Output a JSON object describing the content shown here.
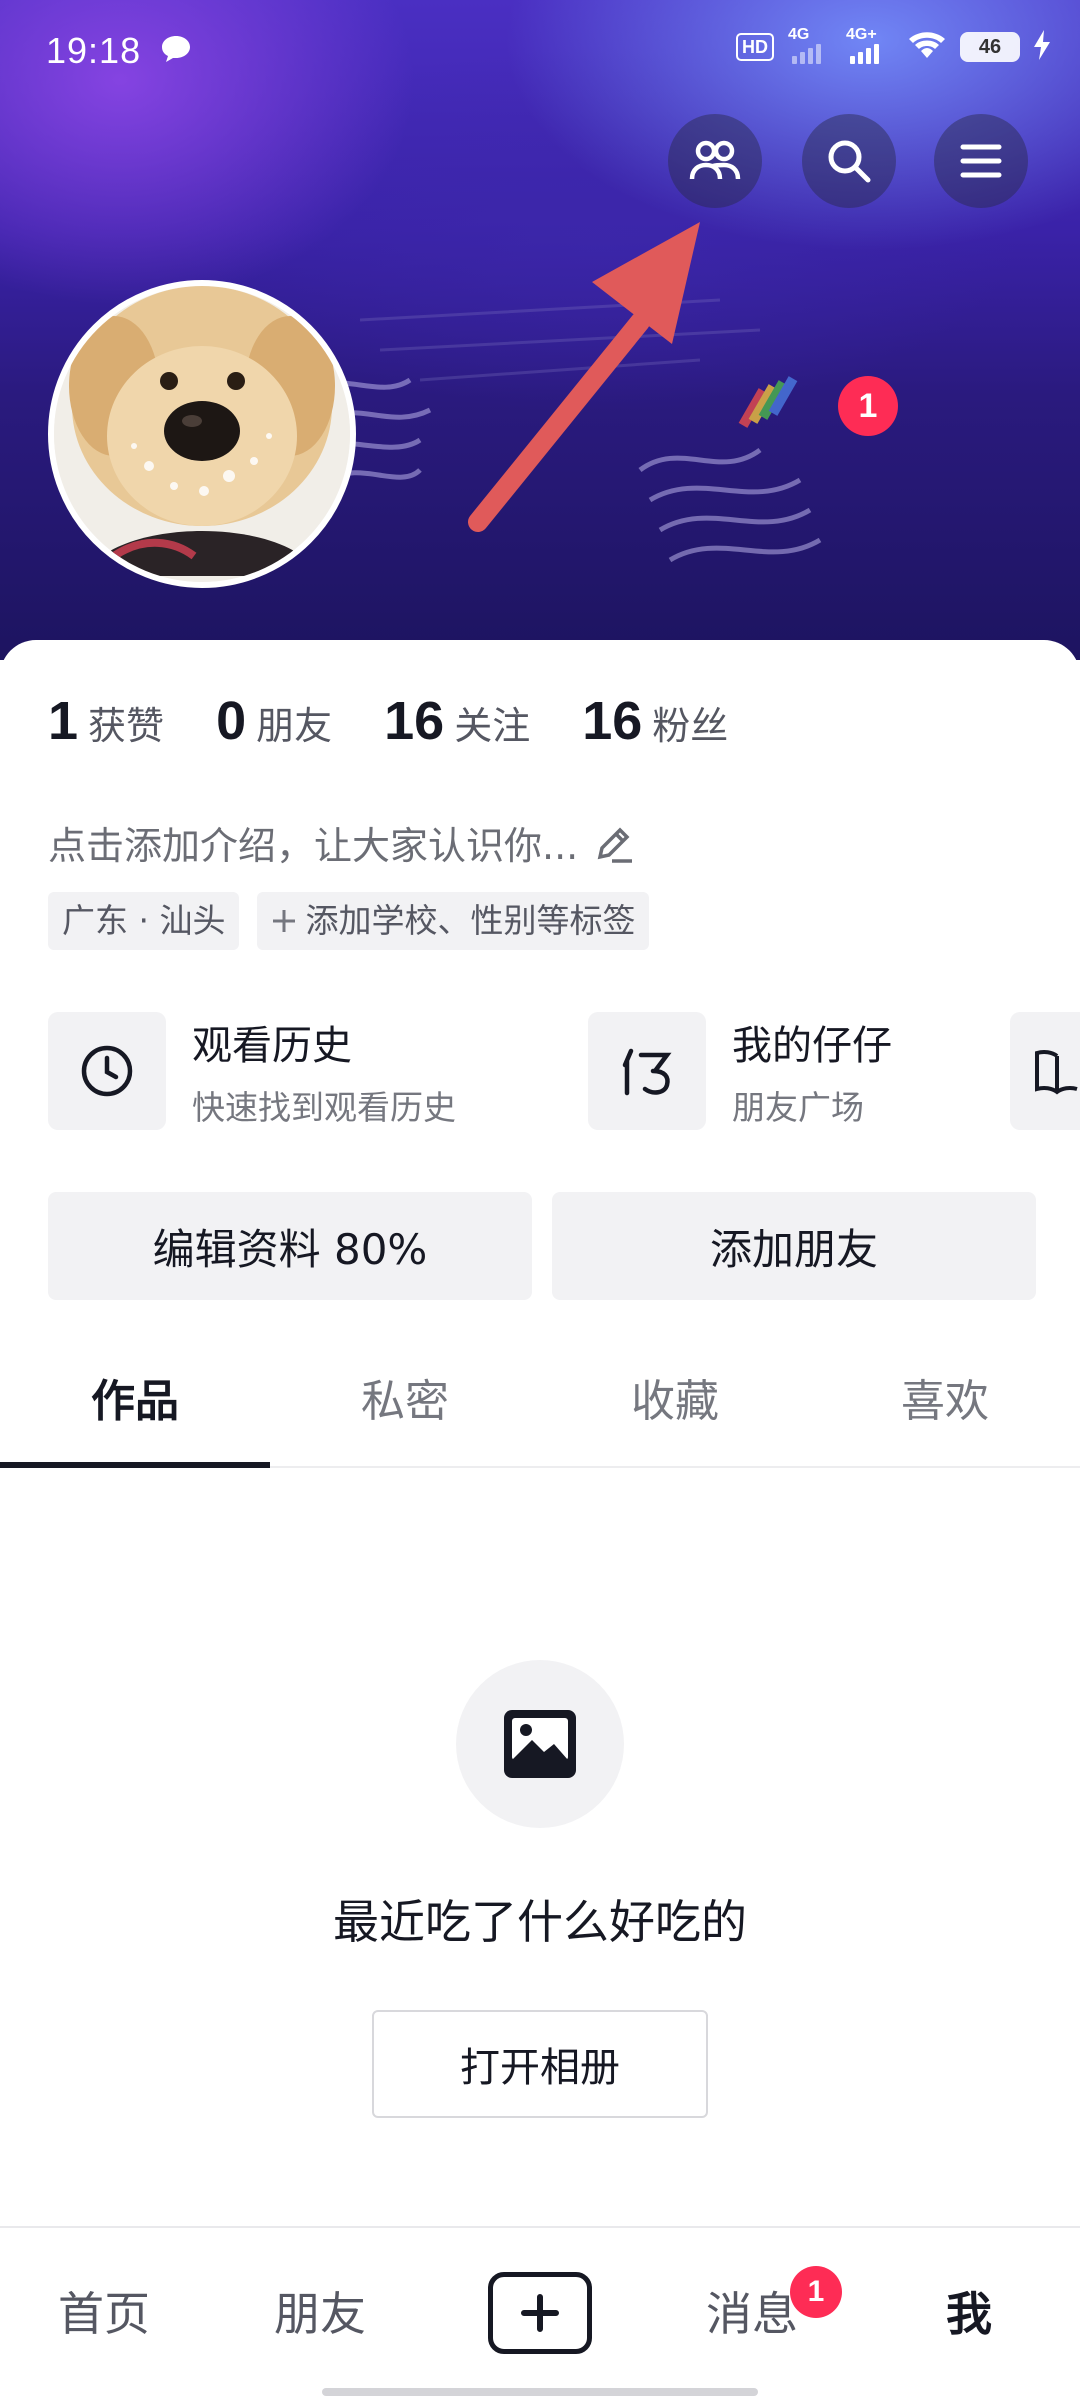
{
  "status_bar": {
    "time": "19:18",
    "hd_label": "HD",
    "signal1_label": "4G",
    "signal2_label": "4G+",
    "battery": "46",
    "icons": [
      "message-icon",
      "wifi-icon",
      "charging-icon"
    ]
  },
  "header": {
    "buttons": [
      "friends-icon",
      "search-icon",
      "menu-icon"
    ],
    "notification_count": "1"
  },
  "stats": [
    {
      "num": "1",
      "label": "获赞"
    },
    {
      "num": "0",
      "label": "朋友"
    },
    {
      "num": "16",
      "label": "关注"
    },
    {
      "num": "16",
      "label": "粉丝"
    }
  ],
  "bio": {
    "placeholder": "点击添加介绍，让大家认识你..."
  },
  "tags": {
    "location": "广东 · 汕头",
    "add_tags": "添加学校、性别等标签"
  },
  "shortcuts": [
    {
      "title": "观看历史",
      "subtitle": "快速找到观看历史",
      "icon": "clock-icon"
    },
    {
      "title": "我的仔仔",
      "subtitle": "朋友广场",
      "icon": "zaizai-icon"
    },
    {
      "icon": "book-icon"
    }
  ],
  "actions": {
    "edit_profile": "编辑资料 80%",
    "add_friends": "添加朋友"
  },
  "tabs": [
    "作品",
    "私密",
    "收藏",
    "喜欢"
  ],
  "active_tab": 0,
  "empty_state": {
    "icon": "image-icon",
    "text": "最近吃了什么好吃的",
    "button": "打开相册"
  },
  "bottom_nav": {
    "items": [
      "首页",
      "朋友",
      "消息",
      "我"
    ],
    "active": "我",
    "messages_badge": "1"
  },
  "colors": {
    "accent": "#fe2c55",
    "annotation_arrow": "#e05a5a",
    "banner_dark": "#1d1460",
    "banner_light": "#6a60e8"
  }
}
